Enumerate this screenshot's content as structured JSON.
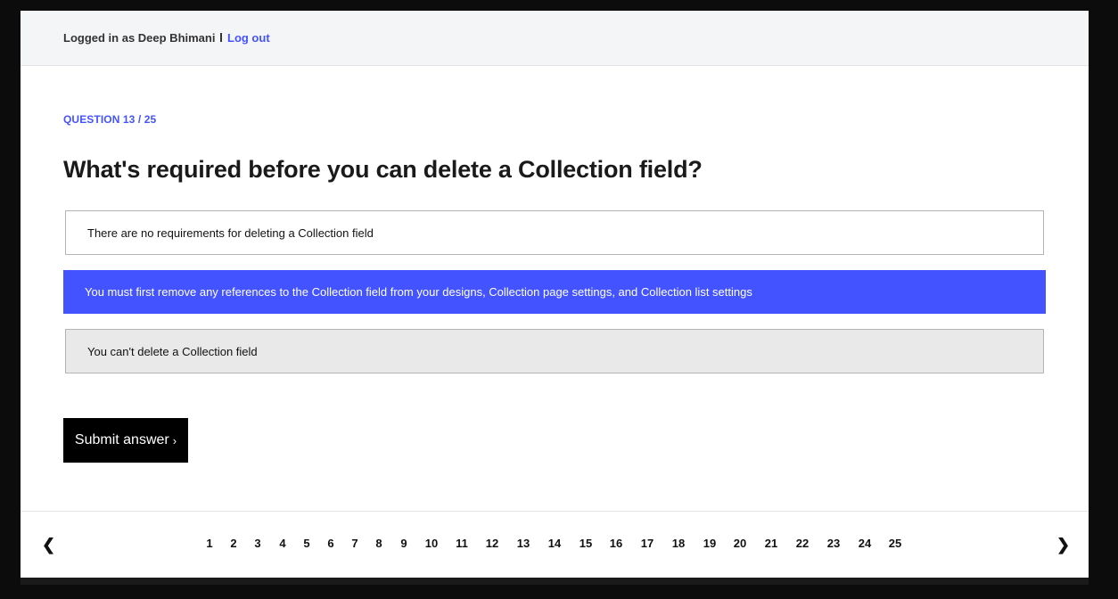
{
  "header": {
    "logged_in_text": "Logged in as Deep Bhimani",
    "logout_label": "Log out"
  },
  "quiz": {
    "counter": "QUESTION 13 / 25",
    "question": "What's required before you can delete a Collection field?",
    "options": [
      {
        "label": "There are no requirements for deleting a Collection field",
        "state": "default"
      },
      {
        "label": "You must first remove any references to the Collection field from your designs, Collection page settings, and Collection list settings",
        "state": "selected"
      },
      {
        "label": "You can't delete a Collection field",
        "state": "hover"
      }
    ],
    "submit_label": "Submit answer",
    "submit_arrow": "›"
  },
  "pagination": {
    "prev": "❮",
    "next": "❯",
    "pages": [
      "1",
      "2",
      "3",
      "4",
      "5",
      "6",
      "7",
      "8",
      "9",
      "10",
      "11",
      "12",
      "13",
      "14",
      "15",
      "16",
      "17",
      "18",
      "19",
      "20",
      "21",
      "22",
      "23",
      "24",
      "25"
    ]
  },
  "colors": {
    "accent": "#4353ff",
    "background": "#0c0c0c",
    "topbar": "#f4f5f7",
    "hover_option": "#e9e9e9"
  }
}
